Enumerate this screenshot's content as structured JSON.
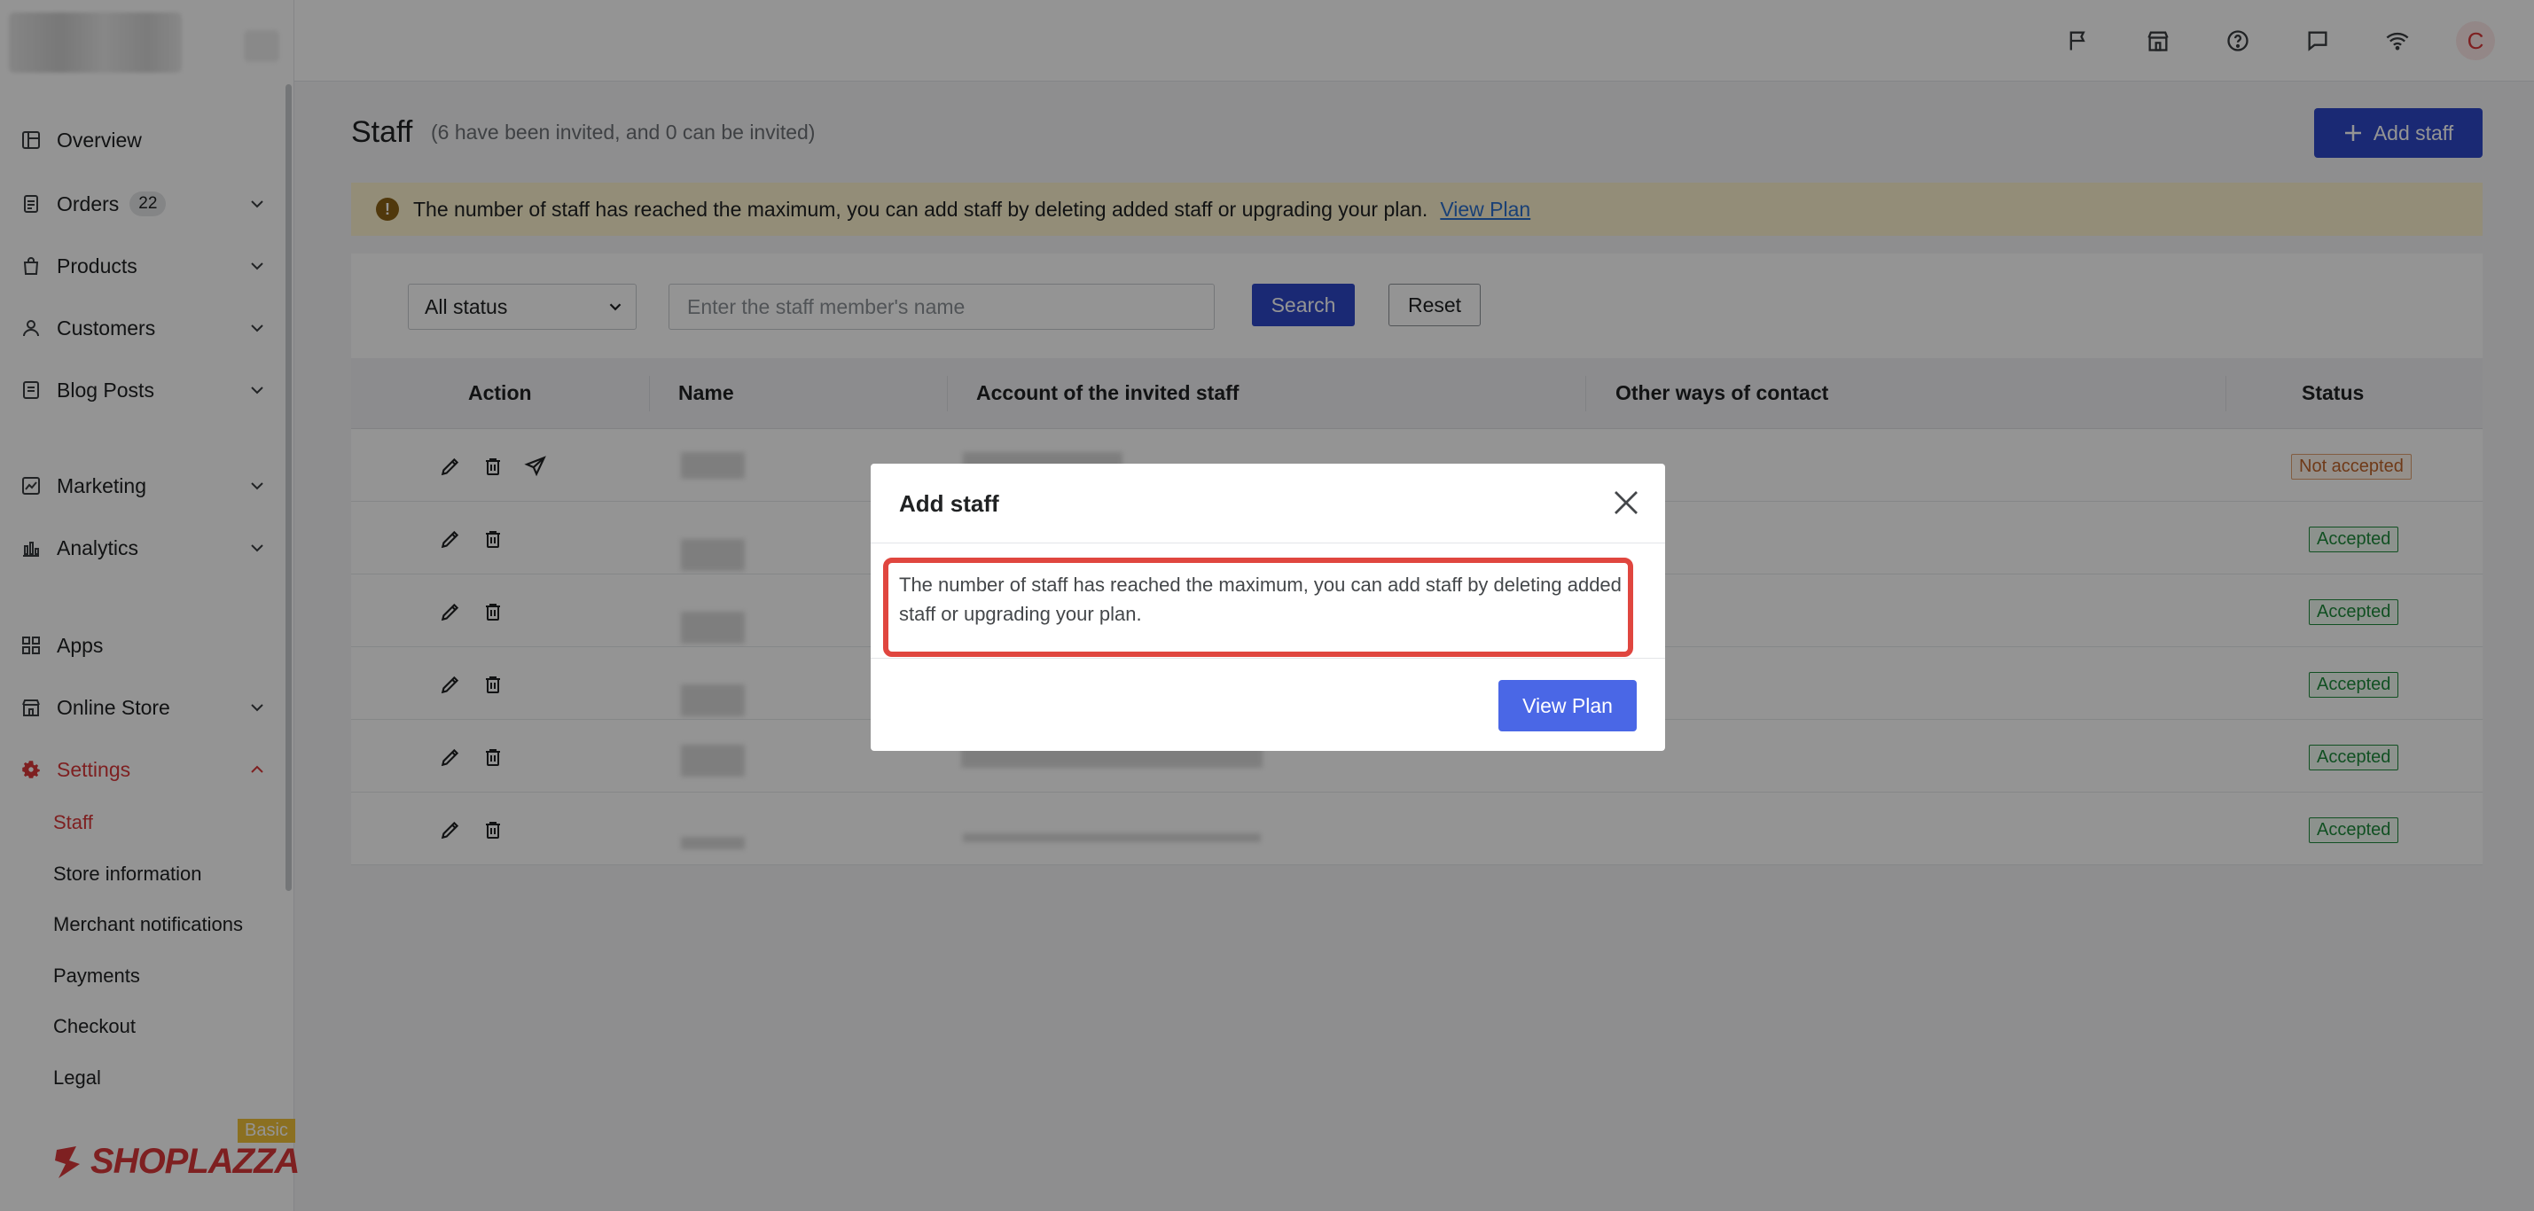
{
  "sidebar": {
    "items": [
      {
        "label": "Overview",
        "icon": "overview-icon"
      },
      {
        "label": "Orders",
        "icon": "orders-icon",
        "badge": "22"
      },
      {
        "label": "Products",
        "icon": "products-icon"
      },
      {
        "label": "Customers",
        "icon": "customers-icon"
      },
      {
        "label": "Blog Posts",
        "icon": "blog-posts-icon"
      },
      {
        "label": "Marketing",
        "icon": "marketing-icon"
      },
      {
        "label": "Analytics",
        "icon": "analytics-icon"
      },
      {
        "label": "Apps",
        "icon": "apps-icon"
      },
      {
        "label": "Online Store",
        "icon": "online-store-icon"
      },
      {
        "label": "Settings",
        "icon": "settings-icon"
      }
    ],
    "settings_sub": [
      "Staff",
      "Store information",
      "Merchant notifications",
      "Payments",
      "Checkout",
      "Legal"
    ],
    "brand": "SHOPLAZZA",
    "plan_tag": "Basic"
  },
  "topbar": {
    "icons": [
      "flag-icon",
      "store-icon",
      "help-icon",
      "chat-icon",
      "wifi-icon"
    ],
    "avatar_initial": "C"
  },
  "page": {
    "title": "Staff",
    "subtitle": "(6 have been invited, and 0 can be invited)",
    "add_button": "Add staff",
    "banner_text": "The number of staff has reached the maximum, you can add staff by deleting added staff or upgrading your plan.",
    "banner_link": "View Plan"
  },
  "filters": {
    "status_select": "All status",
    "search_placeholder": "Enter the staff member's name",
    "search_button": "Search",
    "reset_button": "Reset"
  },
  "table": {
    "columns": [
      "Action",
      "Name",
      "Account of the invited staff",
      "Other ways of contact",
      "Status"
    ],
    "rows": [
      {
        "status": "Not accepted"
      },
      {
        "status": "Accepted"
      },
      {
        "status": "Accepted"
      },
      {
        "status": "Accepted"
      },
      {
        "status": "Accepted"
      },
      {
        "status": "Accepted"
      }
    ]
  },
  "modal": {
    "title": "Add staff",
    "message": "The number of staff has reached the maximum, you can add staff by deleting added staff or upgrading your plan.",
    "button": "View Plan"
  },
  "colors": {
    "accent": "#2e48c9",
    "modal_button": "#4a67e6",
    "active_nav": "#d9383a",
    "highlight": "#e0463f",
    "banner_bg": "#fdf3cf"
  }
}
